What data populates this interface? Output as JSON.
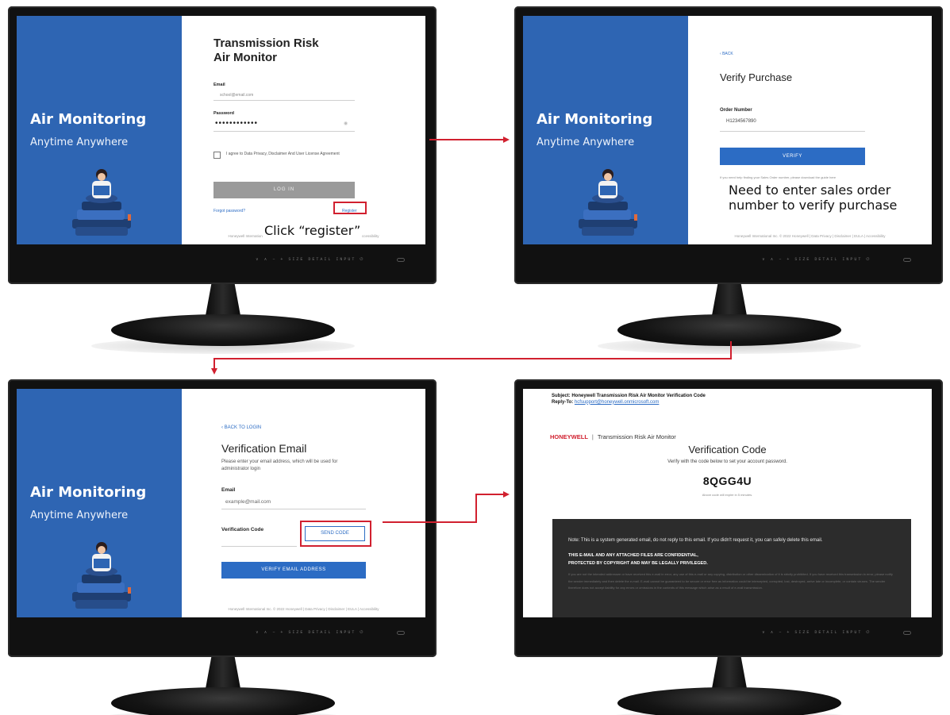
{
  "app": {
    "title_line1": "Air Monitoring",
    "title_line2": "Anytime Anywhere",
    "footer": "Honeywell International Inc. © 2022 Honeywell  |  Data Privacy  |  Disclaimer  |  EULA  |  Accessibility"
  },
  "login": {
    "title_line1": "Transmission Risk",
    "title_line2": "Air Monitor",
    "email_label": "Email",
    "email_value": "school@email.com",
    "password_label": "Password",
    "password_value": "••••••••••••",
    "agree_text": "I agree to Data Privacy, Disclaimer And User License Agreement",
    "login_button": "LOG IN",
    "forgot_link": "Forgot password?",
    "register_link": "Register"
  },
  "verify": {
    "back_link": "BACK",
    "title": "Verify Purchase",
    "order_label": "Order Number",
    "order_value": "H1234567890",
    "verify_button": "VERIFY",
    "help_text": "If you need help finding your Sales Order number, please download the guide here"
  },
  "verification_email": {
    "back_link": "BACK TO LOGIN",
    "title": "Verification Email",
    "desc": "Please enter your email address, which will be used for administrator login",
    "email_label": "Email",
    "email_value": "example@mail.com",
    "code_label": "Verification Code",
    "send_button": "SEND CODE",
    "verify_button": "VERIFY EMAIL ADDRESS"
  },
  "email": {
    "subject": "Subject: Honeywell Transmission Risk Air Monitor Verification Code",
    "reply_label": "Reply-To:",
    "reply_address": "hcfsupport@honeywell.onmicrosoft.com",
    "brand": "HONEYWELL",
    "separator": "|",
    "product": "Transmission Risk Air Monitor",
    "title": "Verification Code",
    "subtitle": "Verify with the code below to set your account password.",
    "code": "8QGG4U",
    "expire": "Above code will expire in 5 minutes.",
    "note": "Note: This is a system generated email, do not reply to this email. If you didn't request it, you can safely delete this email.",
    "confidential_1": "THIS E-MAIL AND ANY ATTACHED FILES ARE CONFIDENTIAL,",
    "confidential_2": "PROTECTED BY COPYRIGHT AND MAY BE LEGALLY PRIVILEGED.",
    "fine_print": "If you are not the intended addressee or have received this e-mail in error, any use of this e-mail or any copying, distribution or other dissemination of it is strictly prohibited. If you have received this transmission in error, please notify the sender immediately and then delete the e-mail. E-mail cannot be guaranteed to be secure or error free as information could be intercepted, corrupted, lost, destroyed, arrive late or incomplete, or contain viruses. The sender therefore does not accept liability for any errors or omissions in the contents of this message which arise as a result of e-mail transmission."
  },
  "annotations": {
    "click_register": "Click “register”",
    "enter_sales_order": "Need to enter sales order number to verify purchase"
  },
  "monitor": {
    "buttons": "∨  ∧  −  +  SIZE  DETAIL  INPUT   ⏻"
  },
  "colors": {
    "brand_blue": "#2e65b3",
    "button_blue": "#2c6cc4",
    "highlight_red": "#d1202f"
  }
}
